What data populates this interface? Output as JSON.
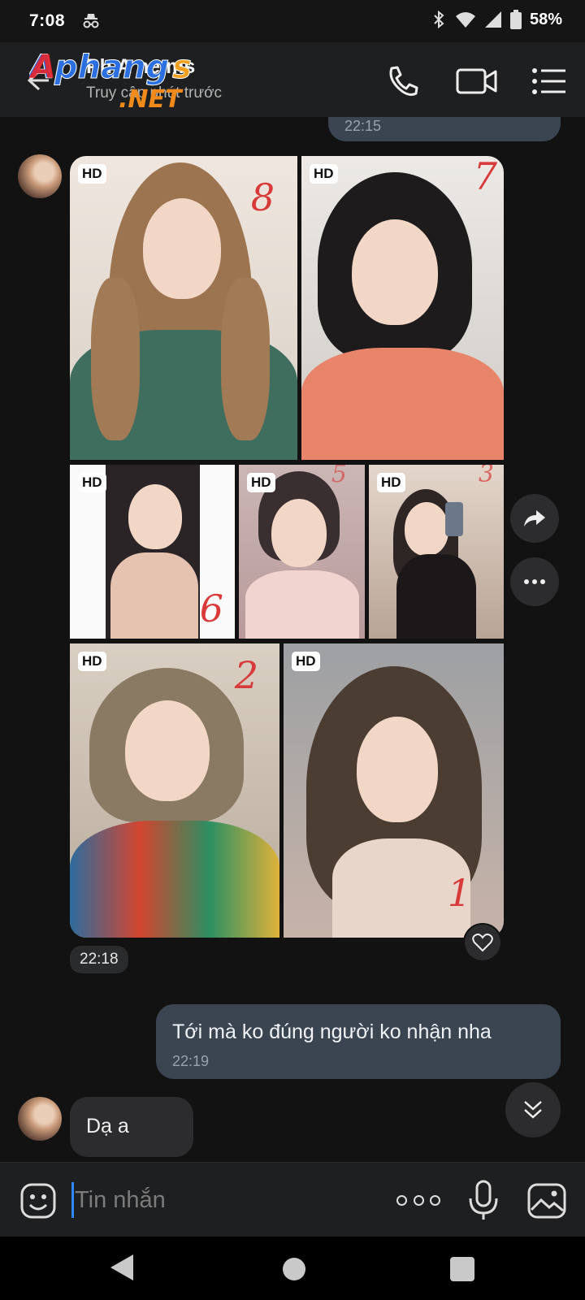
{
  "status_bar": {
    "time": "7:08",
    "battery": "58%"
  },
  "header": {
    "contact_name": "Ph  A     ne ms",
    "contact_status": "Truy cập     phút trước",
    "watermark_line1": "Aphang",
    "watermark_s": "s",
    "watermark_line2": ".NET"
  },
  "chat": {
    "prev_time": "22:15",
    "photo_hd_badges": [
      "HD",
      "HD",
      "HD",
      "HD",
      "HD",
      "HD",
      "HD"
    ],
    "photo_numbers": [
      "8",
      "7",
      "6",
      "5",
      "3",
      "2",
      "1"
    ],
    "photos_time": "22:18",
    "outgoing_message": {
      "text": "Tới mà ko đúng người ko nhận nha",
      "time": "22:19"
    },
    "incoming_message": {
      "text": "Dạ a"
    }
  },
  "input": {
    "placeholder": "Tin nhắn"
  },
  "colors": {
    "accent": "#2f87ff",
    "outgoing_bubble": "#3b4552",
    "incoming_bubble": "#2c2c2e"
  }
}
